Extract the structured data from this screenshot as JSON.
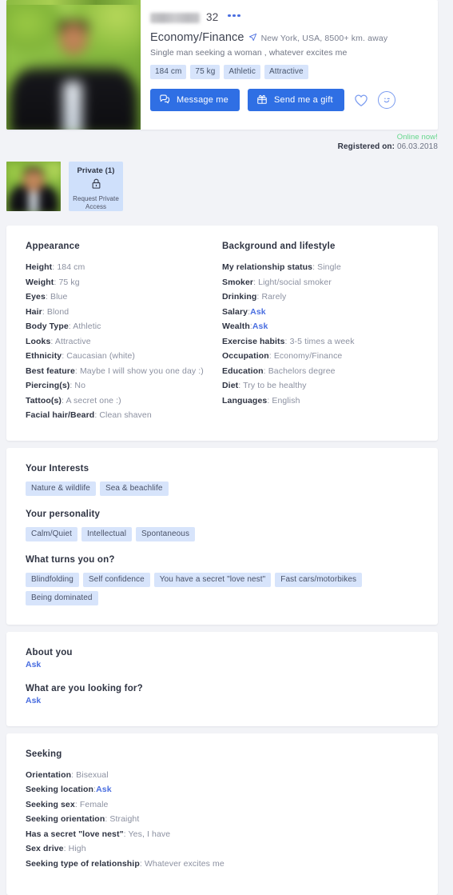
{
  "profile": {
    "name_redacted": true,
    "age": "32",
    "occupation": "Economy/Finance",
    "location": "New York, USA, 8500+ km. away",
    "tagline": "Single man seeking a woman , whatever excites me",
    "chips": [
      "184 cm",
      "75 kg",
      "Athletic",
      "Attractive"
    ],
    "online_status": "Online now!",
    "registered_label": "Registered on:",
    "registered_date": "06.03.2018"
  },
  "actions": {
    "message": "Message me",
    "gift": "Send me a gift",
    "favourite_icon": "heart-icon",
    "wink_icon": "wink-smiley-icon",
    "menu_icon": "more-options-icon",
    "location_icon": "location-pin-icon",
    "message_icon": "chat-bubble-icon",
    "gift_icon": "gift-box-icon"
  },
  "photos": {
    "private_title": "Private (1)",
    "private_sub": "Request Private Access",
    "lock_icon": "lock-icon"
  },
  "appearance": {
    "title": "Appearance",
    "rows": [
      {
        "label": "Height",
        "value": "184 cm"
      },
      {
        "label": "Weight",
        "value": "75 kg"
      },
      {
        "label": "Eyes",
        "value": "Blue"
      },
      {
        "label": "Hair",
        "value": "Blond"
      },
      {
        "label": "Body Type",
        "value": "Athletic"
      },
      {
        "label": "Looks",
        "value": "Attractive"
      },
      {
        "label": "Ethnicity",
        "value": "Caucasian (white)"
      },
      {
        "label": "Best feature",
        "value": "Maybe I will show you one day :)"
      },
      {
        "label": "Piercing(s)",
        "value": "No"
      },
      {
        "label": "Tattoo(s)",
        "value": "A secret one :)"
      },
      {
        "label": "Facial hair/Beard",
        "value": "Clean shaven"
      }
    ]
  },
  "background": {
    "title": "Background and lifestyle",
    "rows": [
      {
        "label": "My relationship status",
        "value": "Single"
      },
      {
        "label": "Smoker",
        "value": "Light/social smoker"
      },
      {
        "label": "Drinking",
        "value": "Rarely"
      },
      {
        "label": "Salary",
        "value": "Ask",
        "link": true
      },
      {
        "label": "Wealth",
        "value": "Ask",
        "link": true
      },
      {
        "label": "Exercise habits",
        "value": "3-5 times a week"
      },
      {
        "label": "Occupation",
        "value": "Economy/Finance"
      },
      {
        "label": "Education",
        "value": "Bachelors degree"
      },
      {
        "label": "Diet",
        "value": "Try to be healthy"
      },
      {
        "label": "Languages",
        "value": "English"
      }
    ]
  },
  "tag_sections": [
    {
      "title": "Your Interests",
      "tags": [
        "Nature & wildlife",
        "Sea & beachlife"
      ]
    },
    {
      "title": "Your personality",
      "tags": [
        "Calm/Quiet",
        "Intellectual",
        "Spontaneous"
      ]
    },
    {
      "title": "What turns you on?",
      "tags": [
        "Blindfolding",
        "Self confidence",
        "You have a secret \"love nest\"",
        "Fast cars/motorbikes",
        "Being dominated"
      ]
    }
  ],
  "free_text": [
    {
      "title": "About you",
      "answer": "Ask",
      "link": true
    },
    {
      "title": "What are you looking for?",
      "answer": "Ask",
      "link": true
    }
  ],
  "seeking": {
    "title": "Seeking",
    "rows": [
      {
        "label": "Orientation",
        "value": "Bisexual"
      },
      {
        "label": "Seeking location",
        "value": "Ask",
        "link": true
      },
      {
        "label": "Seeking sex",
        "value": "Female"
      },
      {
        "label": "Seeking orientation",
        "value": "Straight"
      },
      {
        "label": "Has a secret \"love nest\"",
        "value": "Yes, I have"
      },
      {
        "label": "Sex drive",
        "value": "High"
      },
      {
        "label": "Seeking type of relationship",
        "value": "Whatever excites me"
      }
    ]
  },
  "colors": {
    "accent": "#2f6fe4",
    "link": "#4a6ee0",
    "chip_bg": "#d7e4fb",
    "online": "#63d68a",
    "page_bg": "#f2f3f7"
  }
}
